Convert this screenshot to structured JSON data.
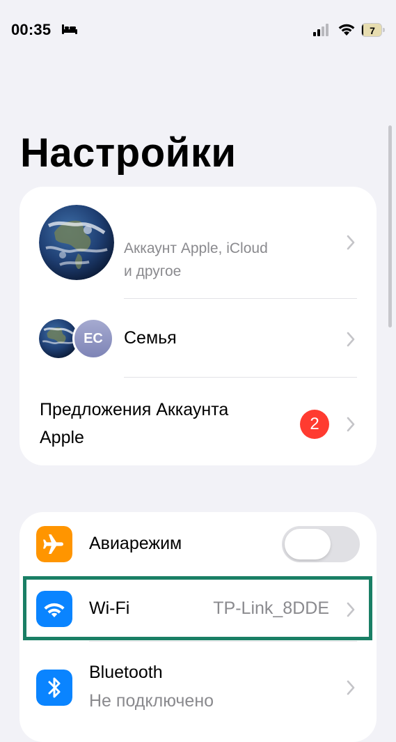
{
  "status_bar": {
    "time": "00:35",
    "battery_level": "7",
    "battery_fraction": 0.07,
    "icons": [
      "bed-icon",
      "cellular-signal-icon",
      "wifi-icon",
      "battery-icon"
    ]
  },
  "title": "Настройки",
  "account": {
    "subtitle_line1": "Аккаунт Apple, iCloud",
    "subtitle_line2": "и другое",
    "avatar_icon": "earth-avatar"
  },
  "family": {
    "label": "Семья",
    "member_initials": "EC"
  },
  "suggestions": {
    "label_line1": "Предложения Аккаунта",
    "label_line2": "Apple",
    "badge_count": "2"
  },
  "airplane": {
    "label": "Авиарежим",
    "icon": "airplane-icon",
    "enabled": false
  },
  "wifi": {
    "label": "Wi-Fi",
    "value": "TP-Link_8DDE",
    "icon": "wifi-icon"
  },
  "bluetooth": {
    "label": "Bluetooth",
    "value": "Не подключено",
    "icon": "bluetooth-icon"
  },
  "colors": {
    "background": "#F2F2F7",
    "airplane_icon": "#FF9500",
    "wifi_icon": "#0A84FF",
    "bluetooth_icon": "#0A84FF",
    "badge": "#FF3B30",
    "highlight": "#1A7F65"
  }
}
